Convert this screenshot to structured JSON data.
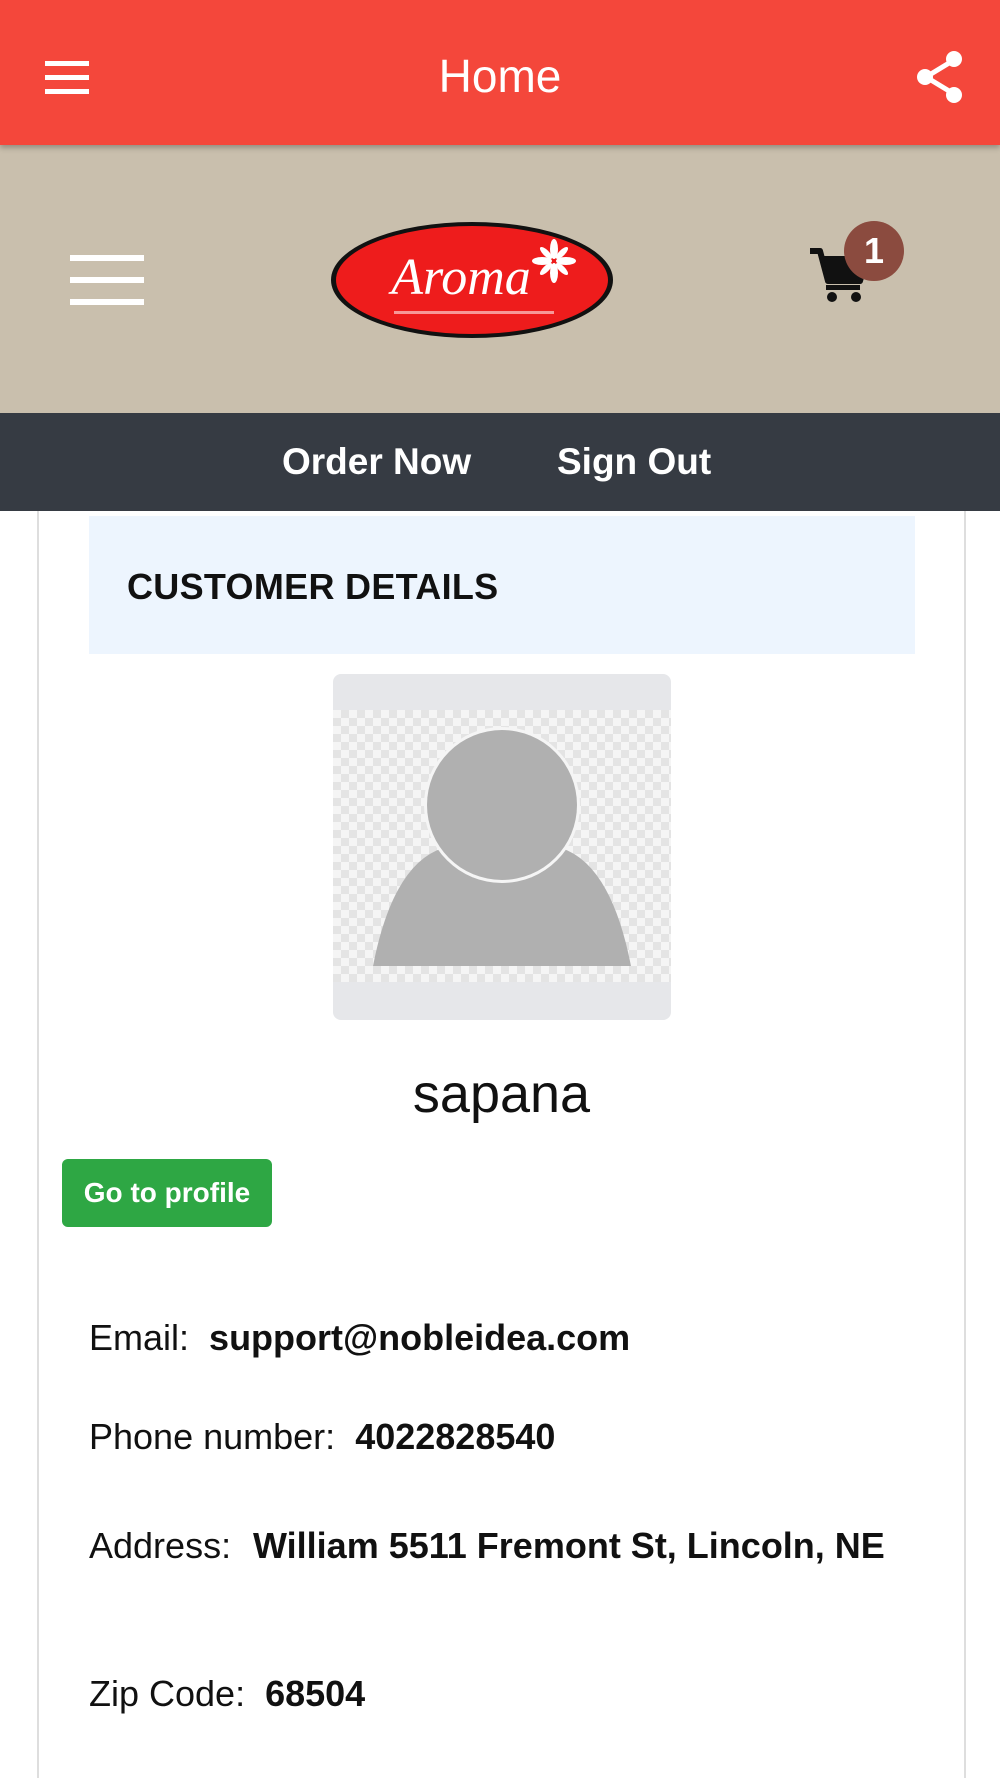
{
  "app_bar": {
    "title": "Home",
    "menu_icon": "hamburger-menu-icon",
    "share_icon": "share-icon"
  },
  "header": {
    "logo_text": "Aroma",
    "menu_icon": "hamburger-menu-icon",
    "cart_icon": "shopping-cart-icon",
    "cart_count": "1"
  },
  "nav": {
    "order_now": "Order Now",
    "sign_out": "Sign Out"
  },
  "customer": {
    "section_title": "CUSTOMER DETAILS",
    "avatar_icon": "user-placeholder-icon",
    "name": "sapana",
    "profile_button": "Go to profile",
    "email_label": "Email:",
    "email": "support@nobleidea.com",
    "phone_label": "Phone number:",
    "phone": "4022828540",
    "address_label": "Address:",
    "address": "William 5511 Fremont St, Lincoln, NE",
    "zip_label": "Zip Code:",
    "zip": "68504"
  },
  "colors": {
    "app_bar": "#f4473b",
    "header_bg": "#c9bfad",
    "nav_bg": "#363b43",
    "section_header_bg": "#edf5fe",
    "profile_button": "#2ea744",
    "cart_badge": "#8b4b3f",
    "logo_red": "#ee1c1c"
  }
}
